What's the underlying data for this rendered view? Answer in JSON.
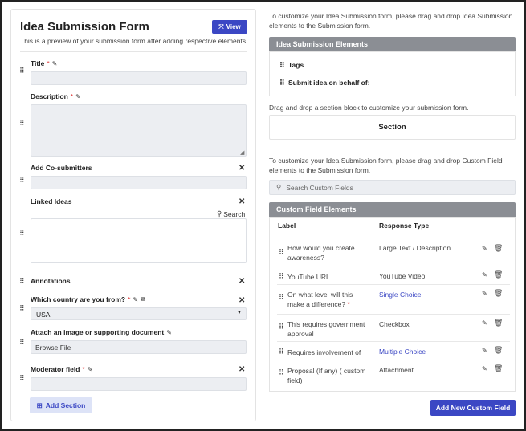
{
  "form": {
    "title": "Idea Submission Form",
    "view_label": "View",
    "subtitle": "This is a preview of your submission form after adding respective elements.",
    "fields": {
      "title": "Title",
      "description": "Description",
      "co_submitters": "Add Co-submitters",
      "linked_ideas": "Linked Ideas",
      "linked_search": "Search",
      "annotations": "Annotations",
      "country": "Which country are you from?",
      "country_value": "USA",
      "attach": "Attach an image or supporting document",
      "browse": "Browse File",
      "moderator": "Moderator field"
    },
    "required_mark": "*",
    "add_section_label": "Add Section"
  },
  "right": {
    "intro_text": "To customize your Idea Submission form, please drag and drop Idea Submission elements to the Submission form.",
    "elements_header": "Idea Submission Elements",
    "elements": [
      "Tags",
      "Submit idea on behalf of:"
    ],
    "section_hint": "Drag and drop a section block to customize your submission form.",
    "section_label": "Section",
    "custom_intro": "To customize your Idea Submission form, please drag and drop Custom Field elements to the Submission form.",
    "search_placeholder": "Search Custom Fields",
    "cf_header": "Custom Field Elements",
    "col_label": "Label",
    "col_type": "Response Type",
    "custom_fields": [
      {
        "label": "How would you create awareness?",
        "type": "Large Text / Description"
      },
      {
        "label": "YouTube URL",
        "type": "YouTube Video"
      },
      {
        "label": "On what level will this make a difference?",
        "type": "Single Choice"
      },
      {
        "label": "This requires government approval",
        "type": "Checkbox"
      },
      {
        "label": "Requires involvement of",
        "type": "Multiple Choice"
      },
      {
        "label": "Proposal (If any) ( custom field)",
        "type": "Attachment"
      }
    ],
    "add_custom_label": "Add New Custom Field"
  },
  "colors": {
    "accent": "#3b47c4",
    "header_gray": "#8b8e94",
    "required": "#dd3333"
  }
}
